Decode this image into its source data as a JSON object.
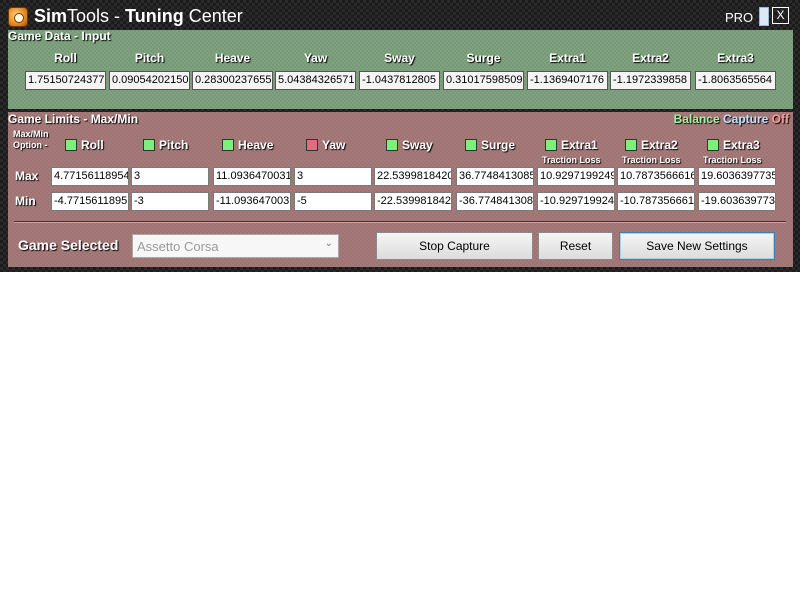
{
  "window": {
    "title_sim": "Sim",
    "title_tools": "Tools - ",
    "title_tuning": "Tuning",
    "title_center": " Center",
    "pro_label": "PRO",
    "close_label": "X"
  },
  "input": {
    "section_title": "Game Data - Input",
    "channels": [
      "Roll",
      "Pitch",
      "Heave",
      "Yaw",
      "Sway",
      "Surge",
      "Extra1",
      "Extra2",
      "Extra3"
    ],
    "values": [
      "1.75150724377",
      "0.09054202150",
      "0.28300237655",
      "5.04384326571",
      "-1.0437812805",
      "0.31017598509",
      "-1.1369407176",
      "-1.1972339858",
      "-1.8063565564"
    ]
  },
  "limits": {
    "section_title": "Game Limits - Max/Min",
    "balance_word": "Balance",
    "capture_word": "Capture",
    "off_word": "Off",
    "option_label_line1": "Max/Min",
    "option_label_line2": "Option -",
    "options": [
      {
        "label": "Roll",
        "color": "#7cf07c"
      },
      {
        "label": "Pitch",
        "color": "#7cf07c"
      },
      {
        "label": "Heave",
        "color": "#7cf07c"
      },
      {
        "label": "Yaw",
        "color": "#e36a80"
      },
      {
        "label": "Sway",
        "color": "#7cf07c"
      },
      {
        "label": "Surge",
        "color": "#7cf07c"
      },
      {
        "label": "Extra1",
        "color": "#7cf07c"
      },
      {
        "label": "Extra2",
        "color": "#7cf07c"
      },
      {
        "label": "Extra3",
        "color": "#7cf07c"
      }
    ],
    "traction_label": "Traction Loss",
    "max_label": "Max",
    "min_label": "Min",
    "max_values": [
      "4.77156118954",
      "3",
      "11.0936470031",
      "3",
      "22.5399818420",
      "36.7748413085",
      "10.9297199249",
      "10.7873566616",
      "19.6036397735"
    ],
    "min_values": [
      "-4.7715611895",
      "-3",
      "-11.093647003",
      "-5",
      "-22.539981842",
      "-36.774841308",
      "-10.929719924",
      "-10.787356661",
      "-19.603639773"
    ]
  },
  "game": {
    "label": "Game Selected",
    "selected": "Assetto Corsa"
  },
  "buttons": {
    "stop_capture": "Stop Capture",
    "reset": "Reset",
    "save": "Save New Settings"
  }
}
